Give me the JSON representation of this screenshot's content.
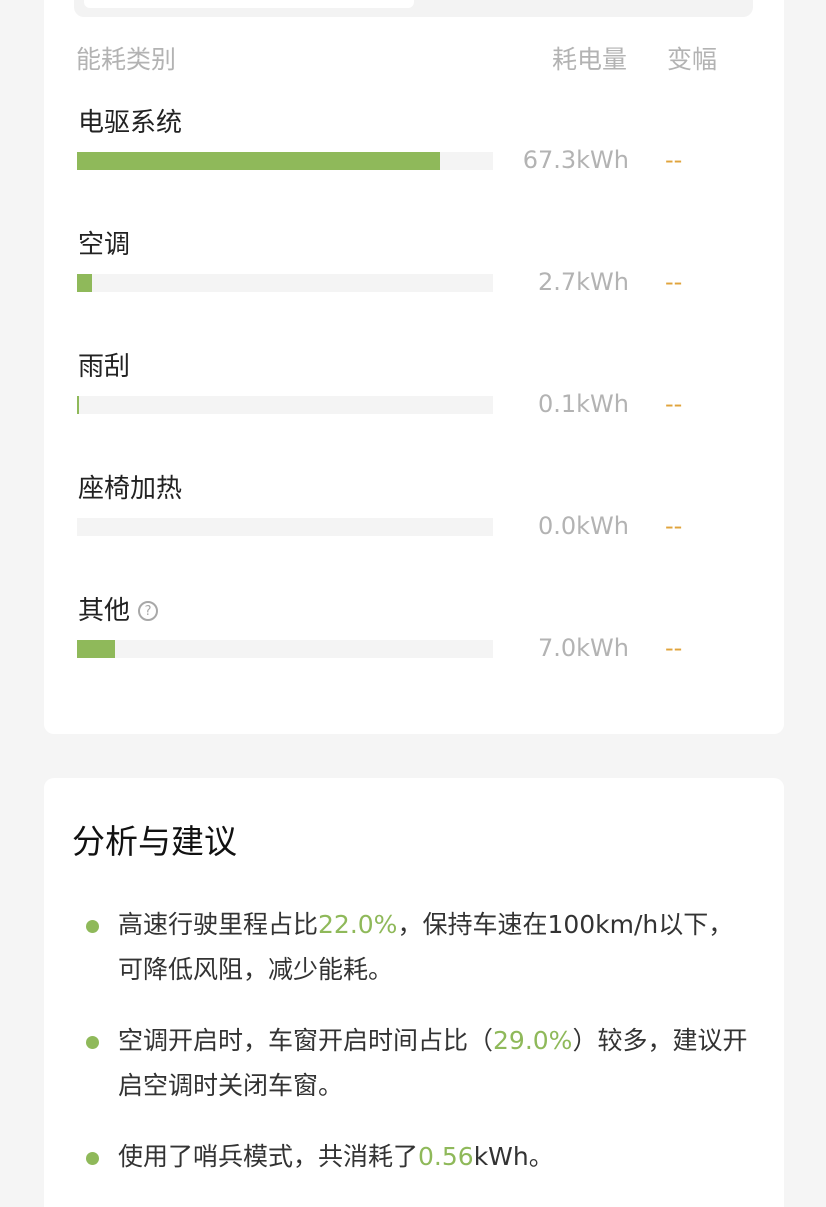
{
  "breakdown": {
    "header": {
      "category": "能耗类别",
      "energy": "耗电量",
      "change": "变幅"
    },
    "rows": [
      {
        "label": "电驱系统",
        "value": "67.3kWh",
        "change": "--",
        "fill_fraction": 0.873
      },
      {
        "label": "空调",
        "value": "2.7kWh",
        "change": "--",
        "fill_fraction": 0.035
      },
      {
        "label": "雨刮",
        "value": "0.1kWh",
        "change": "--",
        "fill_fraction": 0.003
      },
      {
        "label": "座椅加热",
        "value": "0.0kWh",
        "change": "--",
        "fill_fraction": 0.0
      },
      {
        "label": "其他",
        "value": "7.0kWh",
        "change": "--",
        "fill_fraction": 0.091,
        "help_icon": "question-circle-icon"
      }
    ],
    "colors": {
      "bar": "#8fb95a",
      "track": "#f4f4f4",
      "change": "#e0a43c"
    }
  },
  "analysis": {
    "title": "分析与建议",
    "tips": [
      {
        "before": "高速行驶里程占比",
        "highlight": "22.0%",
        "after": "，保持车速在100km/h以下，可降低风阻，减少能耗。"
      },
      {
        "before": "空调开启时，车窗开启时间占比（",
        "highlight": "29.0%",
        "after": "）较多，建议开启空调时关闭车窗。"
      },
      {
        "before": "使用了哨兵模式，共消耗了",
        "highlight": "0.56",
        "after": "kWh。"
      }
    ],
    "colors": {
      "highlight": "#8fb95a",
      "bullet": "#8fb95a"
    }
  }
}
